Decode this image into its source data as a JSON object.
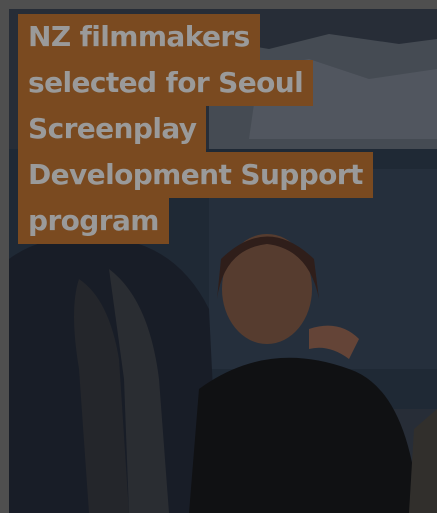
{
  "headline": {
    "lines": [
      "NZ filmmakers",
      "selected for Seoul",
      "Screenplay",
      "Development Support",
      "program"
    ]
  },
  "colors": {
    "headline_background": "#7a4a20",
    "headline_text": "#9a9a9a",
    "page_background": "#5a5a5a"
  },
  "image": {
    "description_icon": "photo-two-people-lake-mountains"
  }
}
